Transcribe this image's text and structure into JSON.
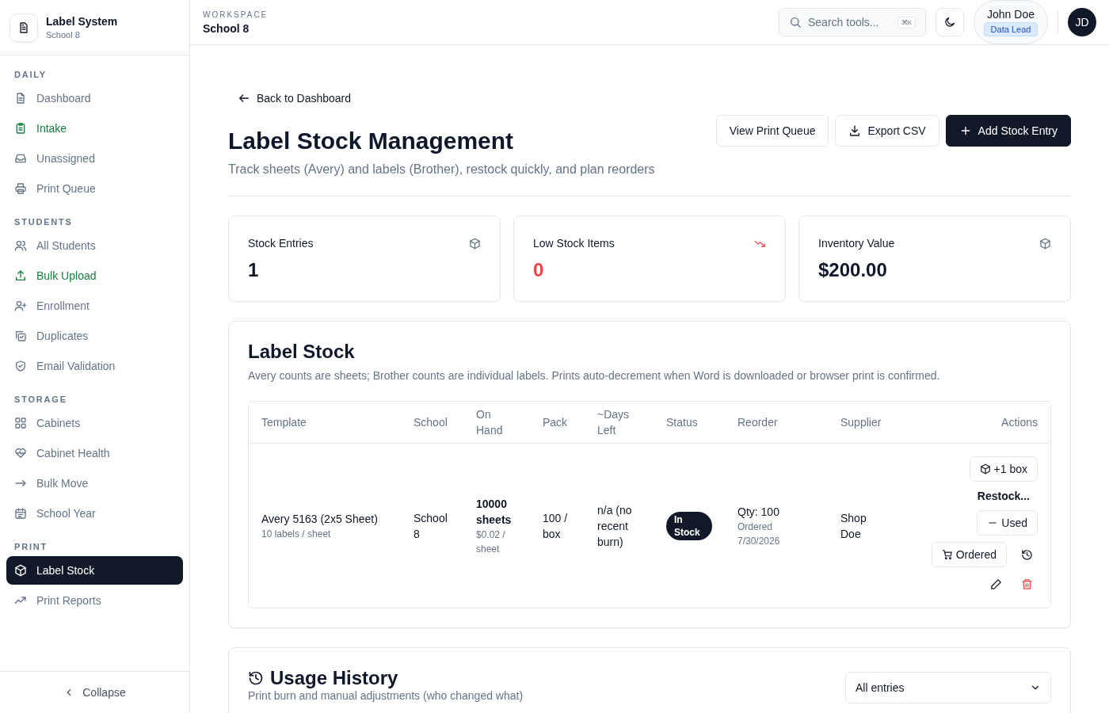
{
  "sidebar": {
    "brand": {
      "title": "Label System",
      "subtitle": "School 8"
    },
    "sections": [
      {
        "heading": "DAILY",
        "items": [
          {
            "label": "Dashboard",
            "color": "#64748b",
            "selected": false
          },
          {
            "label": "Intake",
            "color": "#15803d",
            "selected": false
          },
          {
            "label": "Unassigned",
            "color": "#64748b",
            "selected": false
          },
          {
            "label": "Print Queue",
            "color": "#64748b",
            "selected": false
          }
        ]
      },
      {
        "heading": "STUDENTS",
        "items": [
          {
            "label": "All Students",
            "color": "#64748b",
            "selected": false
          },
          {
            "label": "Bulk Upload",
            "color": "#15803d",
            "selected": false
          },
          {
            "label": "Enrollment",
            "color": "#64748b",
            "selected": false
          },
          {
            "label": "Duplicates",
            "color": "#64748b",
            "selected": false
          },
          {
            "label": "Email Validation",
            "color": "#64748b",
            "selected": false
          }
        ]
      },
      {
        "heading": "STORAGE",
        "items": [
          {
            "label": "Cabinets",
            "color": "#64748b",
            "selected": false
          },
          {
            "label": "Cabinet Health",
            "color": "#64748b",
            "selected": false
          },
          {
            "label": "Bulk Move",
            "color": "#64748b",
            "selected": false
          },
          {
            "label": "School Year",
            "color": "#64748b",
            "selected": false
          }
        ]
      },
      {
        "heading": "PRINT",
        "items": [
          {
            "label": "Label Stock",
            "selected": true
          },
          {
            "label": "Print Reports",
            "color": "#64748b",
            "selected": false
          }
        ]
      }
    ],
    "collapse": "Collapse"
  },
  "topbar": {
    "eyebrow": "WORKSPACE",
    "workspace": "School 8",
    "search": {
      "placeholder": "Search tools...",
      "shortcut": "⌘K"
    },
    "user": {
      "name": "John Doe",
      "role": "Data Lead",
      "initials": "JD"
    }
  },
  "page": {
    "back": "Back to Dashboard",
    "title": "Label Stock Management",
    "subtitle": "Track sheets (Avery) and labels (Brother), restock quickly, and plan reorders",
    "actions": [
      {
        "label": "View Print Queue",
        "kind": "plain"
      },
      {
        "label": "Export CSV",
        "kind": "download"
      },
      {
        "label": "Add Stock Entry",
        "kind": "primary"
      }
    ]
  },
  "stats": [
    {
      "label": "Stock Entries",
      "value": "1",
      "alert": false
    },
    {
      "label": "Low Stock Items",
      "value": "0",
      "alert": true
    },
    {
      "label": "Inventory Value",
      "value": "$200.00",
      "alert": false
    }
  ],
  "label_stock": {
    "title": "Label Stock",
    "description": "Avery counts are sheets; Brother counts are individual labels. Prints auto-decrement when Word is downloaded or browser print is confirmed.",
    "table": {
      "columns": [
        "Template",
        "School",
        "On Hand",
        "Pack",
        "~Days Left",
        "Status",
        "Reorder",
        "Supplier",
        "Actions"
      ],
      "rows": [
        {
          "template": "Avery 5163 (2x5 Sheet)",
          "template_note": "10 labels / sheet",
          "school": "School 8",
          "on_hand": "10000 sheets",
          "on_hand_note": "$0.02 / sheet",
          "pack": "100 / box",
          "days_left": "n/a (no recent burn)",
          "status": "In Stock",
          "reorder": "Qty: 100",
          "reorder_note": "Ordered 7/30/2026",
          "supplier": "Shop Doe",
          "actions": {
            "add": "+1 box",
            "restock": "Restock...",
            "used": "Used",
            "ordered": "Ordered"
          }
        }
      ]
    }
  },
  "usage_history": {
    "title": "Usage History",
    "subtitle": "Print burn and manual adjustments (who changed what)",
    "filter": "All entries"
  }
}
